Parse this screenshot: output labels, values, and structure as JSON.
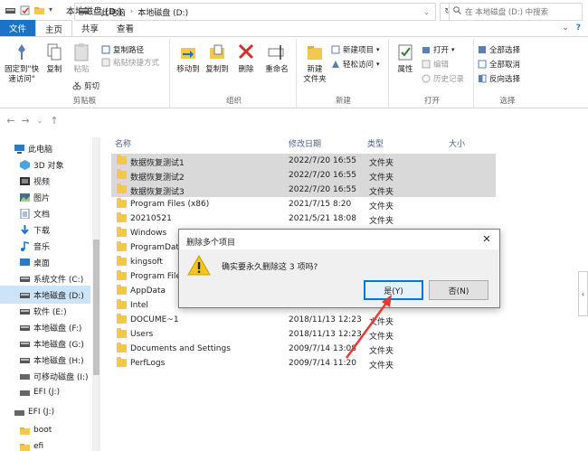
{
  "window": {
    "title": "本地磁盘 (D:)",
    "controls": [
      "—",
      "☐",
      "✕"
    ]
  },
  "ribbon_tabs": {
    "file": "文件",
    "home": "主页",
    "share": "共享",
    "view": "查看",
    "right_chevron": "⌄",
    "help": "?"
  },
  "ribbon": {
    "pin_quick_access_line1": "固定到\"快",
    "pin_quick_access_line2": "速访问\"",
    "copy": "复制",
    "paste": "粘贴",
    "copy_path": "复制路径",
    "paste_shortcut": "粘贴快捷方式",
    "cut": "剪切",
    "clipboard_group": "剪贴板",
    "move_to": "移动到",
    "copy_to": "复制到",
    "delete": "删除",
    "rename": "重命名",
    "organize_group": "组织",
    "new_folder_line1": "新建",
    "new_folder_line2": "文件夹",
    "new_item": "新建项目",
    "easy_access": "轻松访问",
    "new_group": "新建",
    "properties": "属性",
    "open": "打开",
    "edit": "编辑",
    "history": "历史记录",
    "open_group": "打开",
    "select_all": "全部选择",
    "select_none": "全部取消",
    "invert_selection": "反向选择",
    "select_group": "选择"
  },
  "address": {
    "crumb_this_pc": "此电脑",
    "crumb_drive": "本地磁盘 (D:)",
    "search_placeholder": "在 本地磁盘 (D:) 中搜索"
  },
  "nav_pane": {
    "items": [
      {
        "label": "此电脑",
        "icon": "computer-icon"
      },
      {
        "label": "3D 对象",
        "icon": "cube-icon"
      },
      {
        "label": "视频",
        "icon": "video-icon"
      },
      {
        "label": "图片",
        "icon": "picture-icon"
      },
      {
        "label": "文档",
        "icon": "document-icon"
      },
      {
        "label": "下载",
        "icon": "download-icon"
      },
      {
        "label": "音乐",
        "icon": "music-icon"
      },
      {
        "label": "桌面",
        "icon": "desktop-icon"
      },
      {
        "label": "系统文件 (C:)",
        "icon": "drive-icon"
      },
      {
        "label": "本地磁盘 (D:)",
        "icon": "drive-icon"
      },
      {
        "label": "软件 (E:)",
        "icon": "drive-icon"
      },
      {
        "label": "本地磁盘 (F:)",
        "icon": "drive-icon"
      },
      {
        "label": "本地磁盘 (G:)",
        "icon": "drive-icon"
      },
      {
        "label": "本地磁盘 (H:)",
        "icon": "drive-icon"
      },
      {
        "label": "可移动磁盘 (I:)",
        "icon": "usb-drive-icon"
      },
      {
        "label": "EFI (J:)",
        "icon": "usb-drive-icon"
      },
      {
        "label": "EFI (J:)",
        "icon": "usb-drive-icon"
      },
      {
        "label": "boot",
        "icon": "folder-icon"
      },
      {
        "label": "efi",
        "icon": "folder-icon"
      }
    ]
  },
  "file_list": {
    "columns": {
      "name": "名称",
      "modified": "修改日期",
      "type": "类型",
      "size": "大小"
    },
    "rows": [
      {
        "name": "数据恢复测试1",
        "modified": "2022/7/20 16:55",
        "type": "文件夹",
        "selected": true
      },
      {
        "name": "数据恢复测试2",
        "modified": "2022/7/20 16:55",
        "type": "文件夹",
        "selected": true
      },
      {
        "name": "数据恢复测试3",
        "modified": "2022/7/20 16:55",
        "type": "文件夹",
        "selected": true
      },
      {
        "name": "Program Files (x86)",
        "modified": "2021/7/15 8:20",
        "type": "文件夹",
        "selected": false
      },
      {
        "name": "20210521",
        "modified": "2021/5/21 18:08",
        "type": "文件夹",
        "selected": false
      },
      {
        "name": "Windows",
        "modified": "",
        "type": "",
        "selected": false
      },
      {
        "name": "ProgramData",
        "modified": "",
        "type": "",
        "selected": false
      },
      {
        "name": "kingsoft",
        "modified": "",
        "type": "",
        "selected": false
      },
      {
        "name": "Program Files",
        "modified": "",
        "type": "",
        "selected": false
      },
      {
        "name": "AppData",
        "modified": "",
        "type": "",
        "selected": false
      },
      {
        "name": "Intel",
        "modified": "",
        "type": "",
        "selected": false
      },
      {
        "name": "DOCUME~1",
        "modified": "2018/11/13 12:23",
        "type": "文件夹",
        "selected": false
      },
      {
        "name": "Users",
        "modified": "2018/11/13 12:23",
        "type": "文件夹",
        "selected": false
      },
      {
        "name": "Documents and Settings",
        "modified": "2009/7/14 13:08",
        "type": "文件夹",
        "selected": false
      },
      {
        "name": "PerfLogs",
        "modified": "2009/7/14 11:20",
        "type": "文件夹",
        "selected": false
      }
    ]
  },
  "dialog": {
    "title": "删除多个项目",
    "message": "确实要永久删除这 3 项吗?",
    "yes_button": "是(Y)",
    "no_button": "否(N)",
    "close": "✕"
  },
  "colors": {
    "file_tab": "#1a73c8",
    "selection": "#d9d9d9",
    "nav_selected": "#cce4f7",
    "annotation_arrow": "#e53935",
    "default_button_border": "#0078d7"
  }
}
